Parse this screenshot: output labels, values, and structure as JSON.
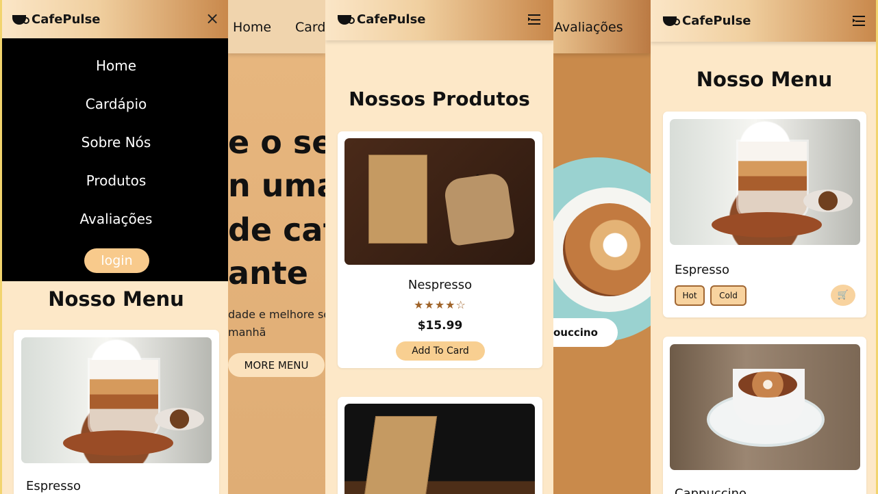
{
  "brand": {
    "name": "CafePulse"
  },
  "nav": {
    "items": [
      "Home",
      "Cardápio",
      "Sobre Nós",
      "Produtos",
      "Avaliações"
    ],
    "login_label": "login",
    "top_home": "Home",
    "top_cardapio_partial": "Card",
    "top_avaliacoes": "Avaliações"
  },
  "hero": {
    "line1": "e o se",
    "line2": "n uma",
    "line3": "de caf",
    "line4": "ante",
    "subtext_line1": "dade e melhore se",
    "subtext_line2": "manhã",
    "more_menu_label": "MORE MENU",
    "cappuccino_label": "ouccino"
  },
  "sections": {
    "menu_title": "Nosso Menu",
    "products_title": "Nossos Produtos"
  },
  "products": [
    {
      "name": "Nespresso",
      "price": "$15.99",
      "rating": 4.5,
      "button_label": "Add To Card"
    }
  ],
  "menu_items": [
    {
      "name": "Espresso",
      "options": [
        "Hot",
        "Cold"
      ]
    },
    {
      "name": "Cappuccino"
    }
  ],
  "colors": {
    "cream": "#fde8c8",
    "tan": "#e2b37b",
    "dark_tan": "#c98a4b",
    "accent": "#f6cd8f",
    "black": "#000000"
  }
}
